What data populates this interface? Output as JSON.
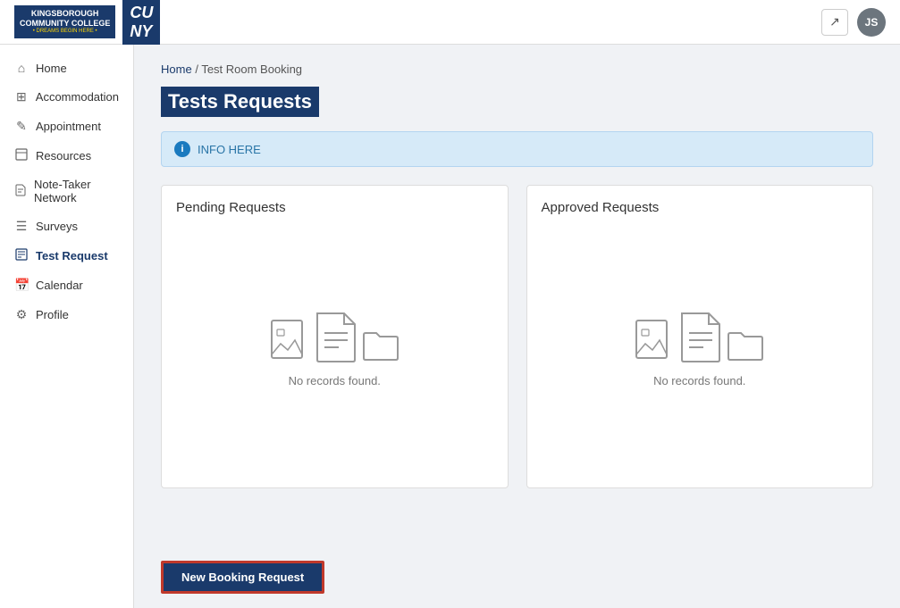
{
  "header": {
    "logo_text": "KINGSBOROUGH\nCOMMUNITY COLLEGE",
    "logo_dreams": "• DREAMS BEGIN HERE •",
    "cuny_label": "CU\nNY",
    "external_link_icon": "↗",
    "avatar_initials": "JS"
  },
  "sidebar": {
    "items": [
      {
        "id": "home",
        "label": "Home",
        "icon": "⌂"
      },
      {
        "id": "accommodation",
        "label": "Accommodation",
        "icon": "⊞"
      },
      {
        "id": "appointment",
        "label": "Appointment",
        "icon": "✎"
      },
      {
        "id": "resources",
        "label": "Resources",
        "icon": "📁"
      },
      {
        "id": "note-taker-network",
        "label": "Note-Taker Network",
        "icon": "📋"
      },
      {
        "id": "surveys",
        "label": "Surveys",
        "icon": "☰"
      },
      {
        "id": "test-request",
        "label": "Test Request",
        "icon": "⊟",
        "active": true
      },
      {
        "id": "calendar",
        "label": "Calendar",
        "icon": "📅"
      },
      {
        "id": "profile",
        "label": "Profile",
        "icon": "⚙"
      }
    ]
  },
  "breadcrumb": {
    "home": "Home",
    "separator": "/",
    "current": "Test Room Booking"
  },
  "page": {
    "title": "Tests Requests",
    "info_banner": "INFO HERE",
    "pending_title": "Pending Requests",
    "approved_title": "Approved Requests",
    "no_records": "No records found.",
    "new_booking_label": "New Booking Request"
  }
}
